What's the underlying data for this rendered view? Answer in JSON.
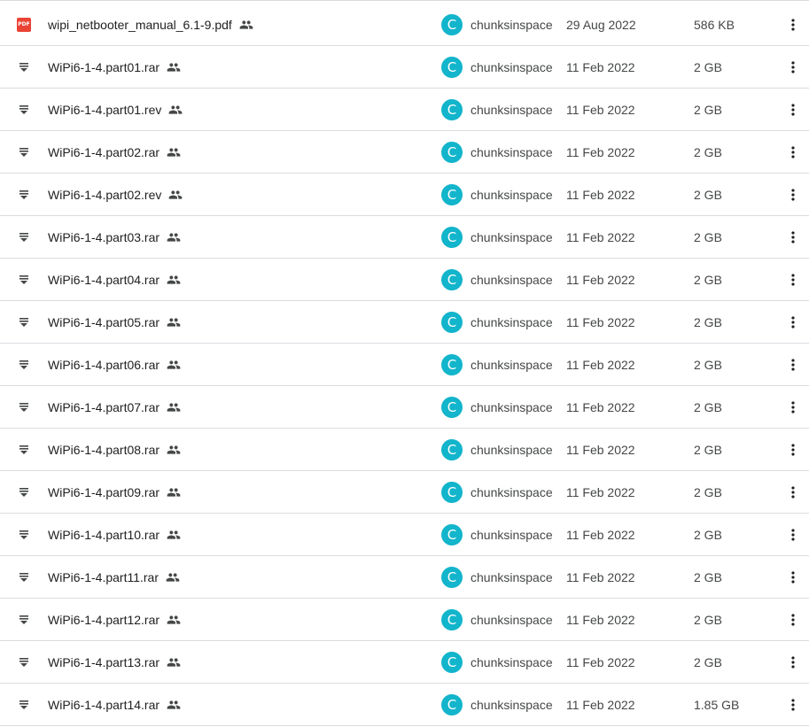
{
  "files": [
    {
      "name": "wipi_netbooter_manual_6.1-9.pdf",
      "type": "pdf",
      "type_label": "PDF",
      "owner": "chunksinspace",
      "owner_initial": "C",
      "modified": "29 Aug 2022",
      "size": "586 KB"
    },
    {
      "name": "WiPi6-1-4.part01.rar",
      "type": "archive",
      "owner": "chunksinspace",
      "owner_initial": "C",
      "modified": "11 Feb 2022",
      "size": "2 GB"
    },
    {
      "name": "WiPi6-1-4.part01.rev",
      "type": "archive",
      "owner": "chunksinspace",
      "owner_initial": "C",
      "modified": "11 Feb 2022",
      "size": "2 GB"
    },
    {
      "name": "WiPi6-1-4.part02.rar",
      "type": "archive",
      "owner": "chunksinspace",
      "owner_initial": "C",
      "modified": "11 Feb 2022",
      "size": "2 GB"
    },
    {
      "name": "WiPi6-1-4.part02.rev",
      "type": "archive",
      "owner": "chunksinspace",
      "owner_initial": "C",
      "modified": "11 Feb 2022",
      "size": "2 GB"
    },
    {
      "name": "WiPi6-1-4.part03.rar",
      "type": "archive",
      "owner": "chunksinspace",
      "owner_initial": "C",
      "modified": "11 Feb 2022",
      "size": "2 GB"
    },
    {
      "name": "WiPi6-1-4.part04.rar",
      "type": "archive",
      "owner": "chunksinspace",
      "owner_initial": "C",
      "modified": "11 Feb 2022",
      "size": "2 GB"
    },
    {
      "name": "WiPi6-1-4.part05.rar",
      "type": "archive",
      "owner": "chunksinspace",
      "owner_initial": "C",
      "modified": "11 Feb 2022",
      "size": "2 GB"
    },
    {
      "name": "WiPi6-1-4.part06.rar",
      "type": "archive",
      "owner": "chunksinspace",
      "owner_initial": "C",
      "modified": "11 Feb 2022",
      "size": "2 GB"
    },
    {
      "name": "WiPi6-1-4.part07.rar",
      "type": "archive",
      "owner": "chunksinspace",
      "owner_initial": "C",
      "modified": "11 Feb 2022",
      "size": "2 GB"
    },
    {
      "name": "WiPi6-1-4.part08.rar",
      "type": "archive",
      "owner": "chunksinspace",
      "owner_initial": "C",
      "modified": "11 Feb 2022",
      "size": "2 GB"
    },
    {
      "name": "WiPi6-1-4.part09.rar",
      "type": "archive",
      "owner": "chunksinspace",
      "owner_initial": "C",
      "modified": "11 Feb 2022",
      "size": "2 GB"
    },
    {
      "name": "WiPi6-1-4.part10.rar",
      "type": "archive",
      "owner": "chunksinspace",
      "owner_initial": "C",
      "modified": "11 Feb 2022",
      "size": "2 GB"
    },
    {
      "name": "WiPi6-1-4.part11.rar",
      "type": "archive",
      "owner": "chunksinspace",
      "owner_initial": "C",
      "modified": "11 Feb 2022",
      "size": "2 GB"
    },
    {
      "name": "WiPi6-1-4.part12.rar",
      "type": "archive",
      "owner": "chunksinspace",
      "owner_initial": "C",
      "modified": "11 Feb 2022",
      "size": "2 GB"
    },
    {
      "name": "WiPi6-1-4.part13.rar",
      "type": "archive",
      "owner": "chunksinspace",
      "owner_initial": "C",
      "modified": "11 Feb 2022",
      "size": "2 GB"
    },
    {
      "name": "WiPi6-1-4.part14.rar",
      "type": "archive",
      "owner": "chunksinspace",
      "owner_initial": "C",
      "modified": "11 Feb 2022",
      "size": "1.85 GB"
    }
  ],
  "icons": {
    "pdf": "pdf-file-icon",
    "archive": "archive-file-icon",
    "shared": "people-icon",
    "more": "more-vert-icon"
  },
  "colors": {
    "avatar": "#12b5cb",
    "pdf": "#ea4335",
    "divider": "#dadce0",
    "icon": "#444746"
  }
}
